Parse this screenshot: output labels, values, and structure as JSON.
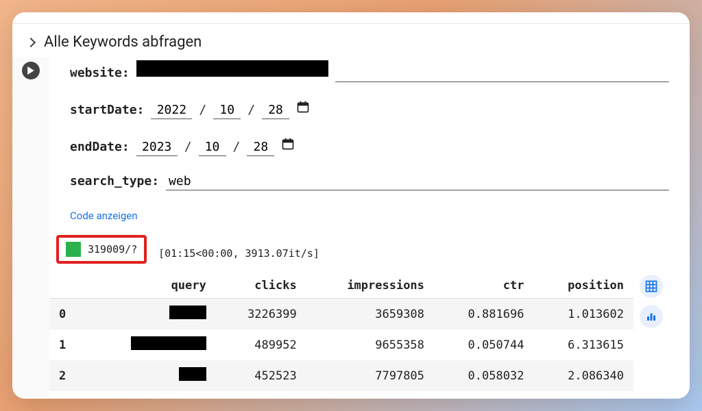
{
  "cell": {
    "title": "Alle Keywords abfragen"
  },
  "form": {
    "website_label": "website:",
    "start_label": "startDate:",
    "end_label": "endDate:",
    "search_label": "search_type:",
    "start": {
      "y": "2022",
      "m": "10",
      "d": "28"
    },
    "end": {
      "y": "2023",
      "m": "10",
      "d": "28"
    },
    "search_type": "web",
    "slash": "/"
  },
  "link": {
    "show_code": "Code anzeigen"
  },
  "progress": {
    "count": "319009/?",
    "tail": "[01:15<00:00, 3913.07it/s]"
  },
  "table": {
    "headers": {
      "idx": "",
      "query": "query",
      "clicks": "clicks",
      "impr": "impressions",
      "ctr": "ctr",
      "pos": "position"
    },
    "rows": [
      {
        "idx": "0",
        "qw": 54,
        "clicks": "3226399",
        "impr": "3659308",
        "ctr": "0.881696",
        "pos": "1.013602"
      },
      {
        "idx": "1",
        "qw": 110,
        "clicks": "489952",
        "impr": "9655358",
        "ctr": "0.050744",
        "pos": "6.313615"
      },
      {
        "idx": "2",
        "qw": 40,
        "clicks": "452523",
        "impr": "7797805",
        "ctr": "0.058032",
        "pos": "2.086340"
      }
    ]
  },
  "chart_data": {
    "type": "table",
    "columns": [
      "query",
      "clicks",
      "impressions",
      "ctr",
      "position"
    ],
    "rows": [
      [
        "(redacted)",
        3226399,
        3659308,
        0.881696,
        1.013602
      ],
      [
        "(redacted)",
        489952,
        9655358,
        0.050744,
        6.313615
      ],
      [
        "(redacted)",
        452523,
        7797805,
        0.058032,
        2.08634
      ]
    ]
  }
}
